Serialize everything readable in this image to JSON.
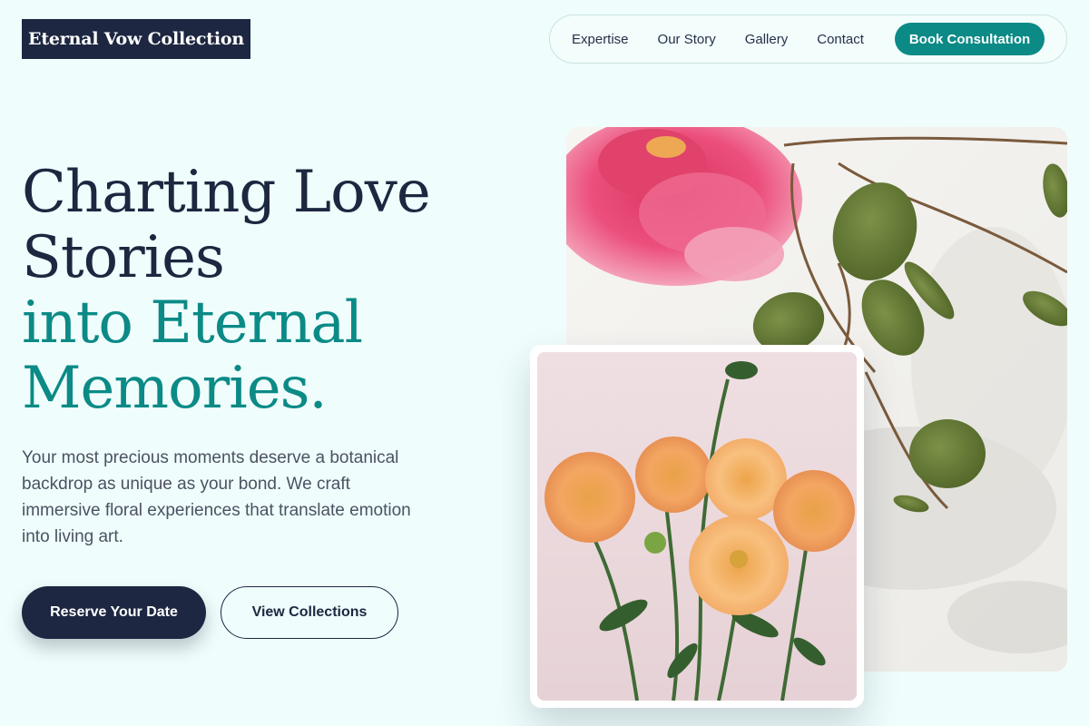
{
  "brand": {
    "name": "Eternal Vow Collection"
  },
  "nav": {
    "links": [
      "Expertise",
      "Our Story",
      "Gallery",
      "Contact"
    ],
    "cta": "Book Consultation"
  },
  "hero": {
    "headline_line1": "Charting Love",
    "headline_line2": "Stories",
    "headline_line3": "into Eternal",
    "headline_line4": "Memories.",
    "lede": "Your most precious moments deserve a botanical backdrop as unique as your bond. We craft immersive floral experiences that translate emotion into living art.",
    "primary_button": "Reserve Your Date",
    "secondary_button": "View Collections"
  },
  "colors": {
    "background": "#effdfc",
    "navy": "#1d2741",
    "teal": "#0b8a86"
  },
  "images": {
    "main": "pink-peony-eucalyptus-photo",
    "inset": "orange-dahlia-bouquet-photo"
  }
}
